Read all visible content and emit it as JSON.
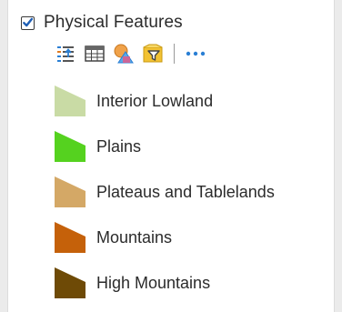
{
  "layer": {
    "title": "Physical Features",
    "checked": true,
    "checkbox_color": "#1f5fb5"
  },
  "toolbar": {
    "tools": [
      {
        "icon": "legend-list-icon"
      },
      {
        "icon": "attribute-table-icon"
      },
      {
        "icon": "change-style-icon"
      },
      {
        "icon": "filter-icon"
      },
      {
        "icon": "more-options-icon"
      }
    ],
    "accent": "#2a7fd4"
  },
  "legend": {
    "items": [
      {
        "label": "Interior Lowland",
        "color": "#c9dba5"
      },
      {
        "label": "Plains",
        "color": "#55d21f"
      },
      {
        "label": "Plateaus and Tablelands",
        "color": "#d4a866"
      },
      {
        "label": "Mountains",
        "color": "#c5610a"
      },
      {
        "label": "High Mountains",
        "color": "#6e4a06"
      }
    ]
  }
}
